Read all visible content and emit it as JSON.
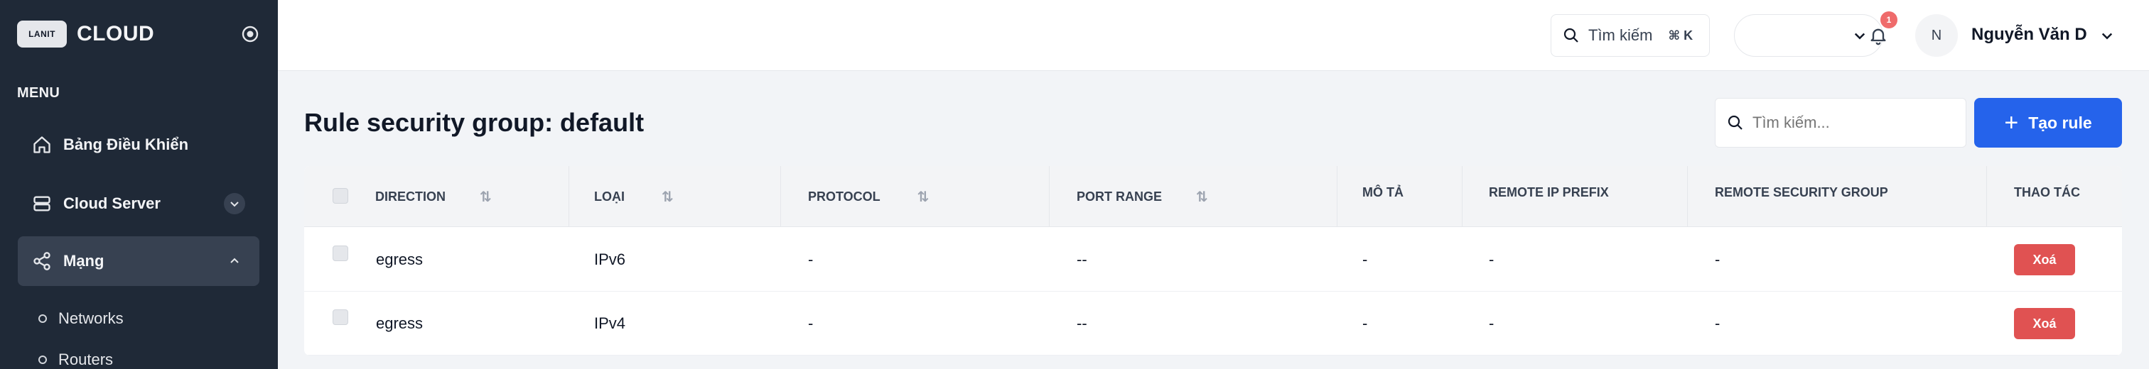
{
  "sidebar": {
    "logo_text": "LANIT",
    "brand": "CLOUD",
    "menu_label": "MENU",
    "items": [
      {
        "label": "Bảng Điều Khiển",
        "icon": "home-icon"
      },
      {
        "label": "Cloud Server",
        "icon": "server-icon"
      },
      {
        "label": "Mạng",
        "icon": "network-share-icon"
      }
    ],
    "sub_items": [
      {
        "label": "Networks"
      },
      {
        "label": "Routers"
      }
    ]
  },
  "topbar": {
    "search_label": "Tìm kiếm",
    "search_shortcut": "⌘ K",
    "select_value": "",
    "notification_count": "1",
    "avatar_initial": "N",
    "user_name": "Nguyễn Văn D"
  },
  "main": {
    "title": "Rule security group: default",
    "search_placeholder": "Tìm kiếm...",
    "create_button": "Tạo rule",
    "table": {
      "headers": [
        "DIRECTION",
        "LOẠI",
        "PROTOCOL",
        "PORT RANGE",
        "MÔ TẢ",
        "REMOTE IP PREFIX",
        "REMOTE SECURITY GROUP",
        "THAO TÁC"
      ],
      "rows": [
        {
          "direction": "egress",
          "type": "IPv6",
          "protocol": "-",
          "port_range": "--",
          "description": "-",
          "remote_ip_prefix": "-",
          "remote_security_group": "-",
          "action": "Xoá"
        },
        {
          "direction": "egress",
          "type": "IPv4",
          "protocol": "-",
          "port_range": "--",
          "description": "-",
          "remote_ip_prefix": "-",
          "remote_security_group": "-",
          "action": "Xoá"
        }
      ]
    }
  },
  "colors": {
    "sidebar_bg": "#1f2937",
    "primary": "#2563eb",
    "danger": "#e05252",
    "badge": "#ef6b6b"
  }
}
